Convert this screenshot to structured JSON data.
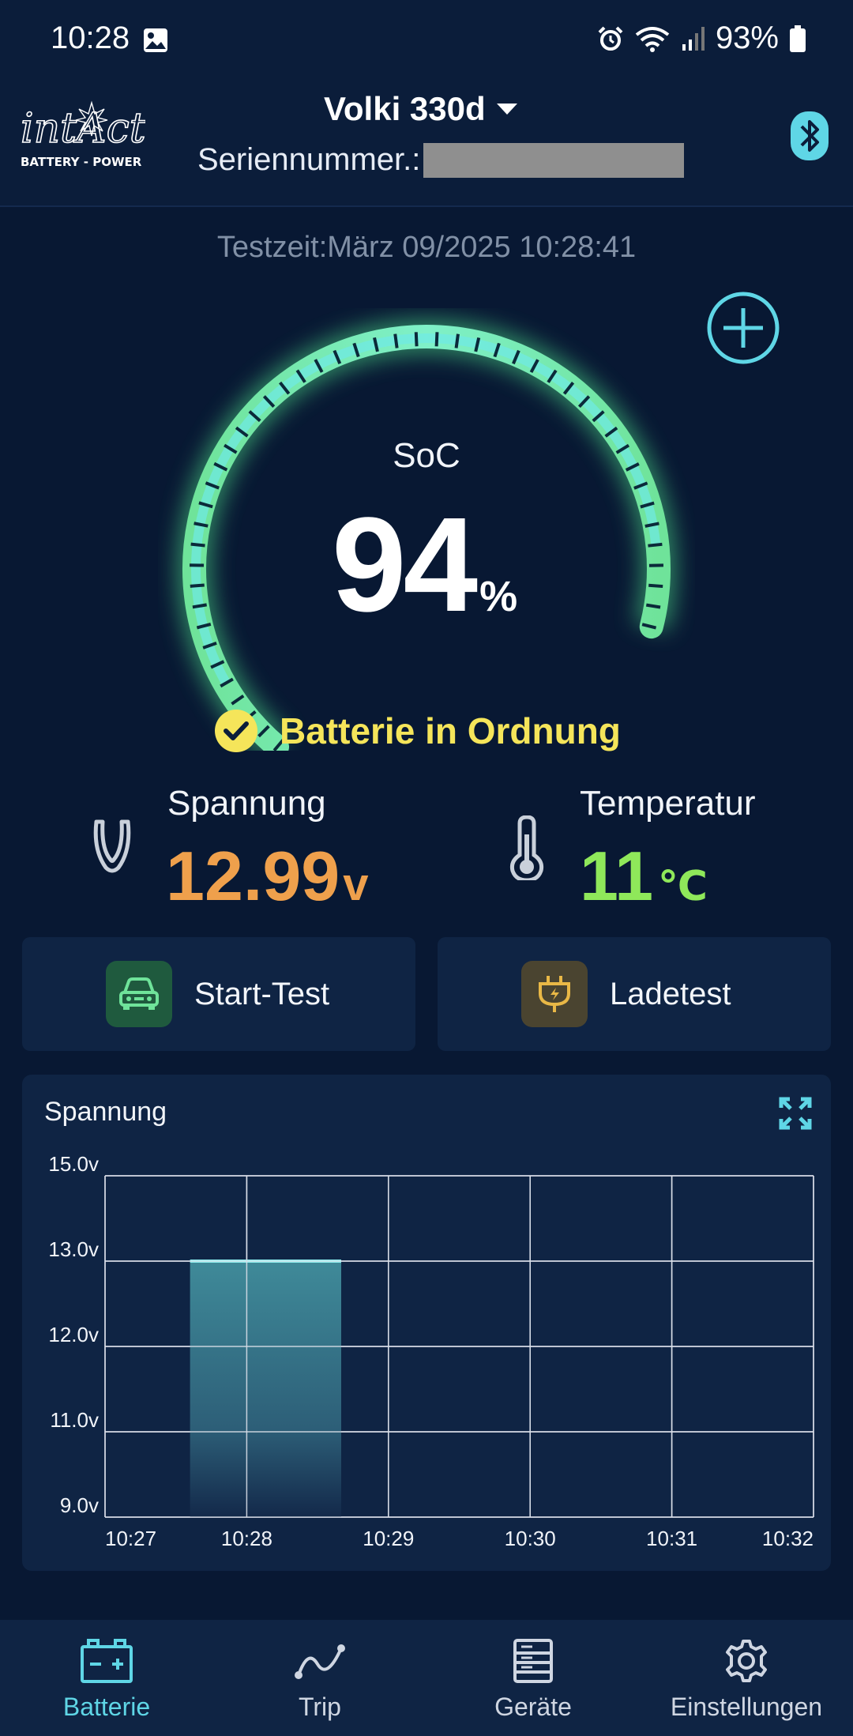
{
  "status_bar": {
    "time": "10:28",
    "battery": "93%"
  },
  "header": {
    "device_name": "Volki 330d",
    "serial_label": "Seriennummer.:",
    "logo_main": "intAct",
    "logo_sub": "BATTERY - POWER"
  },
  "test_time": "Testzeit:März 09/2025 10:28:41",
  "gauge": {
    "label": "SoC",
    "value": "94",
    "unit": "%",
    "level": 0.94
  },
  "status_message": "Batterie in Ordnung",
  "voltage": {
    "label": "Spannung",
    "value": "12.99",
    "unit": "v"
  },
  "temperature": {
    "label": "Temperatur",
    "value": "11",
    "unit": "℃"
  },
  "buttons": {
    "start_test": "Start-Test",
    "charge_test": "Ladetest"
  },
  "colors": {
    "accent": "#5fd6e6",
    "gauge_green": "#7ee89a",
    "status_yellow": "#f5e55a",
    "voltage_orange": "#efa04c",
    "temp_green": "#8fe85a",
    "background": "#081833",
    "card": "#0f2444"
  },
  "chart_data": {
    "type": "bar",
    "title": "Spannung",
    "x_ticks": [
      "10:27",
      "10:28",
      "10:29",
      "10:30",
      "10:31",
      "10:32"
    ],
    "y_ticks": [
      "15.0v",
      "13.0v",
      "12.0v",
      "11.0v",
      "9.0v"
    ],
    "bars": [
      {
        "x_start": "10:27:36",
        "x_end": "10:28:40",
        "value": 13.0
      }
    ],
    "grid": true
  },
  "nav": [
    {
      "label": "Batterie",
      "icon": "battery-icon",
      "active": true
    },
    {
      "label": "Trip",
      "icon": "trip-icon",
      "active": false
    },
    {
      "label": "Geräte",
      "icon": "devices-icon",
      "active": false
    },
    {
      "label": "Einstellungen",
      "icon": "gear-icon",
      "active": false
    }
  ]
}
